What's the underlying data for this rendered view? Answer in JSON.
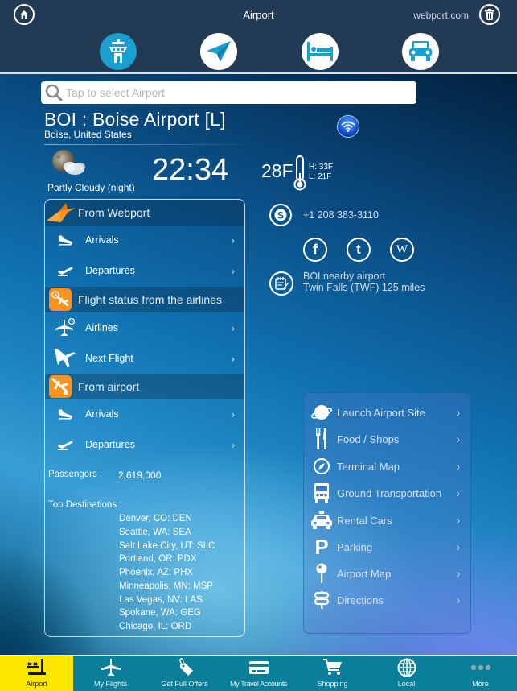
{
  "header": {
    "title": "Airport",
    "site": "webport.com",
    "home_icon": "home-icon",
    "trash_icon": "trash-icon",
    "categories": [
      {
        "name": "airport-tower",
        "icon": "control-tower-icon",
        "active": true
      },
      {
        "name": "flights",
        "icon": "paper-plane-icon",
        "active": false
      },
      {
        "name": "hotels",
        "icon": "bed-icon",
        "active": false
      },
      {
        "name": "cars",
        "icon": "car-icon",
        "active": false
      }
    ]
  },
  "search": {
    "placeholder": "Tap to select Airport",
    "value": ""
  },
  "airport": {
    "name": "BOI : Boise Airport [L]",
    "location": "Boise, United States",
    "weather": "Partly Cloudy (night)",
    "time": "22:34",
    "temperature": "28F",
    "high": "H: 33F",
    "low": "L: 21F"
  },
  "left_panel": {
    "sections": [
      {
        "title": "From Webport",
        "icon": "webport-bird-icon",
        "items": [
          {
            "label": "Arrivals",
            "icon": "arrival-plane-icon"
          },
          {
            "label": "Departures",
            "icon": "departure-plane-icon"
          }
        ]
      },
      {
        "title": "Flight status from the airlines",
        "icon": "flight-status-icon",
        "items": [
          {
            "label": "Airlines",
            "icon": "airline-clock-icon"
          },
          {
            "label": "Next Flight",
            "icon": "plane-icon"
          }
        ]
      },
      {
        "title": "From airport",
        "icon": "from-airport-icon",
        "items": [
          {
            "label": "Arrivals",
            "icon": "arrival-plane-icon"
          },
          {
            "label": "Departures",
            "icon": "departure-plane-icon"
          }
        ]
      }
    ],
    "passengers_label": "Passengers :",
    "passengers_value": "2,619,000",
    "destinations_label": "Top  Destinations :",
    "destinations": [
      "Denver, CO: DEN",
      "Seattle, WA: SEA",
      "Salt Lake City, UT: SLC",
      "Portland, OR: PDX",
      "Phoenix, AZ: PHX",
      "Minneapolis, MN: MSP",
      "Las Vegas, NV: LAS",
      "Spokane, WA: GEG",
      "Chicago, IL: ORD"
    ]
  },
  "contact": {
    "phone": "+1 208 383-3110",
    "social": [
      {
        "icon": "facebook-icon",
        "glyph": "f"
      },
      {
        "icon": "twitter-icon",
        "glyph": "t"
      },
      {
        "icon": "wikipedia-icon",
        "glyph": "W"
      }
    ],
    "nearby_title": "BOI nearby airport",
    "nearby_detail": "Twin Falls (TWF) 125 miles"
  },
  "right_panel": {
    "items": [
      {
        "label": "Launch Airport Site",
        "icon": "globe-icon"
      },
      {
        "label": "Food / Shops",
        "icon": "fork-knife-icon"
      },
      {
        "label": "Terminal Map",
        "icon": "compass-icon"
      },
      {
        "label": "Ground Transportation",
        "icon": "bus-icon"
      },
      {
        "label": "Rental Cars",
        "icon": "taxi-icon"
      },
      {
        "label": "Parking",
        "icon": "parking-icon"
      },
      {
        "label": "Airport Map",
        "icon": "map-pin-icon"
      },
      {
        "label": "Directions",
        "icon": "signpost-icon"
      }
    ]
  },
  "tabbar": {
    "tabs": [
      {
        "label": "Airport",
        "icon": "airport-icon",
        "active": true
      },
      {
        "label": "My Flights",
        "icon": "plane-icon",
        "active": false
      },
      {
        "label": "Get Full Offers",
        "icon": "tag-icon",
        "active": false
      },
      {
        "label": "My Travel Accounts",
        "icon": "credit-card-icon",
        "active": false
      },
      {
        "label": "Shopping",
        "icon": "cart-icon",
        "active": false
      },
      {
        "label": "Local",
        "icon": "globe-icon",
        "active": false
      },
      {
        "label": "More",
        "icon": "more-dots-icon",
        "active": false
      }
    ]
  },
  "colors": {
    "header_bg": "#233a55",
    "active_category": "#1a9fcf",
    "section_icon": "#f7931e",
    "tabbar_bg": "#0b7f99",
    "tab_active": "#fde500"
  }
}
